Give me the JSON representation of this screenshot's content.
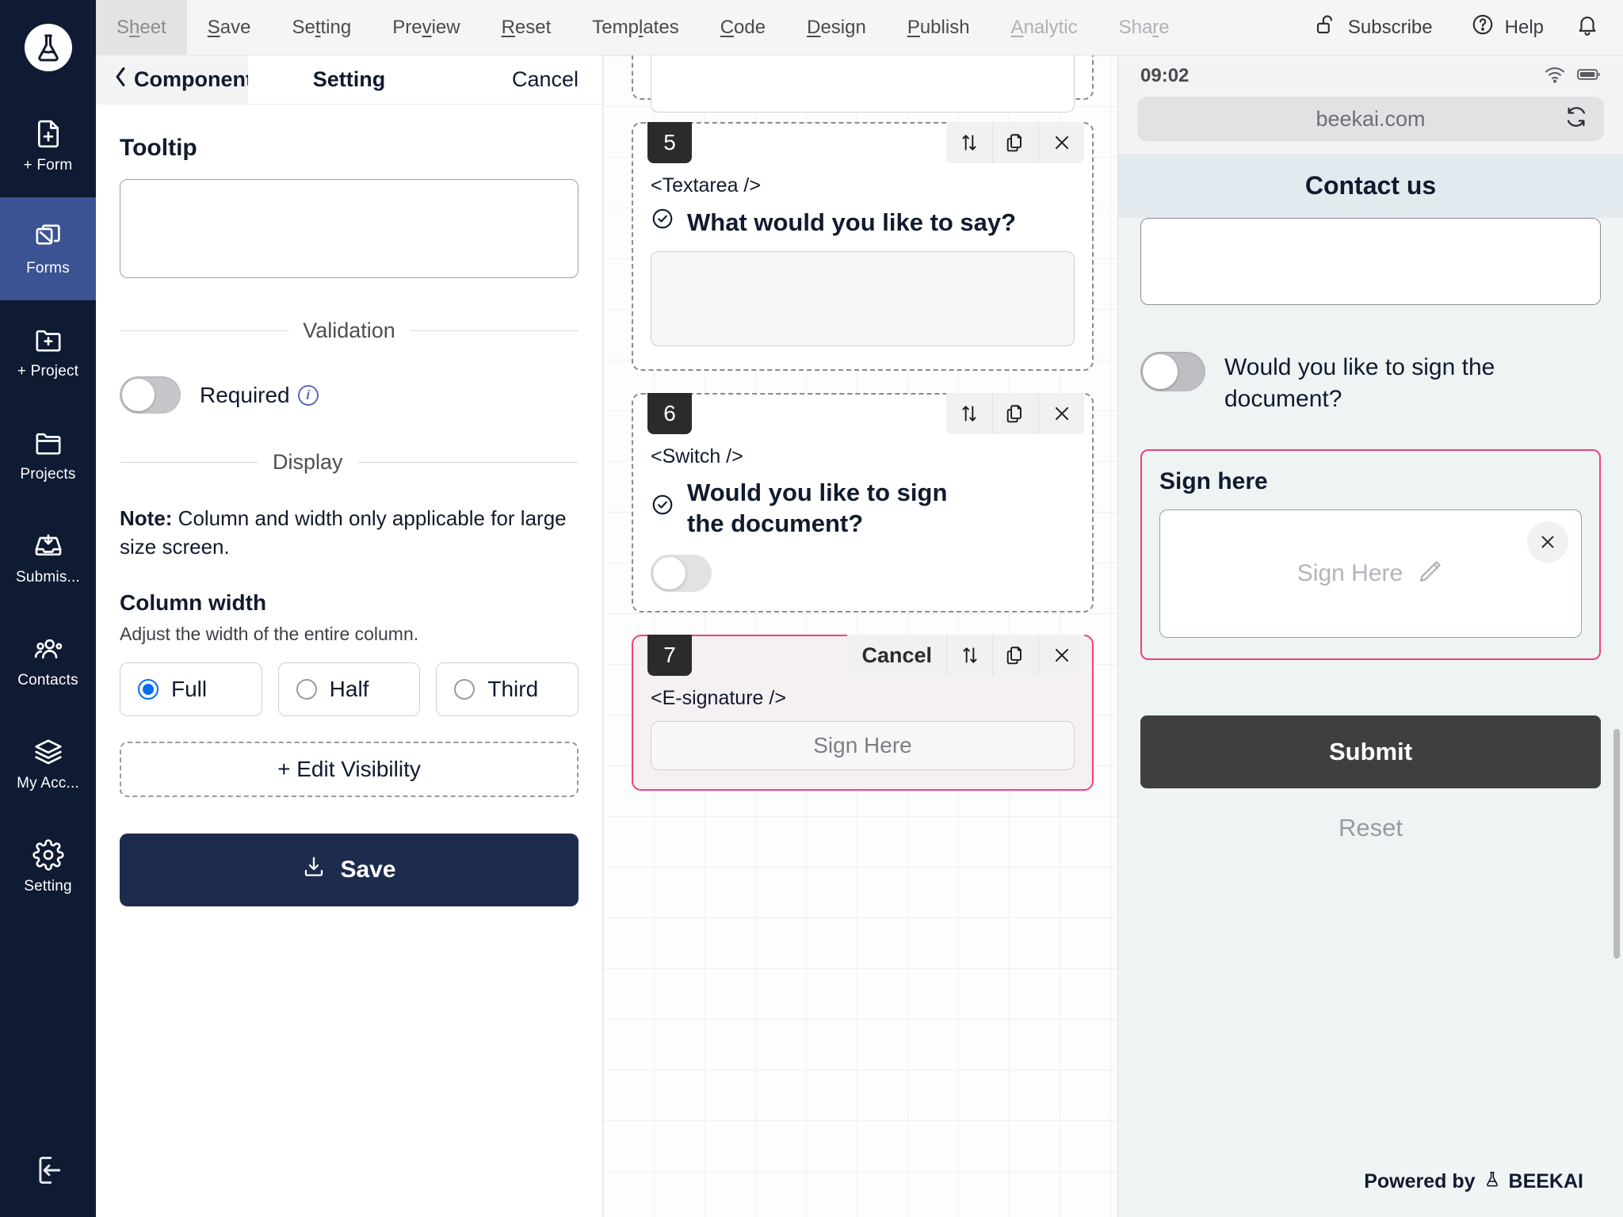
{
  "menubar": {
    "items": [
      {
        "label": "Sheet",
        "accel_index": 1,
        "state": "current"
      },
      {
        "label": "Save",
        "accel_index": 0,
        "state": "normal"
      },
      {
        "label": "Setting",
        "accel_index": 3,
        "state": "normal"
      },
      {
        "label": "Preview",
        "accel_index": 4,
        "state": "normal"
      },
      {
        "label": "Reset",
        "accel_index": 0,
        "state": "normal"
      },
      {
        "label": "Templates",
        "accel_index": 4,
        "state": "normal"
      },
      {
        "label": "Code",
        "accel_index": 0,
        "state": "normal"
      },
      {
        "label": "Design",
        "accel_index": 0,
        "state": "normal"
      },
      {
        "label": "Publish",
        "accel_index": 0,
        "state": "normal"
      },
      {
        "label": "Analytic",
        "accel_index": 0,
        "state": "dim"
      },
      {
        "label": "Share",
        "accel_index": 4,
        "state": "dim"
      }
    ],
    "subscribe_label": "Subscribe",
    "subscribe_icon": "unlock-icon",
    "help_label": "Help",
    "help_icon": "question-circle-icon",
    "bell_icon": "bell-icon"
  },
  "sidebar": {
    "logo_icon": "beekai-flask-logo",
    "items": [
      {
        "label": "+ Form",
        "icon": "file-plus-icon",
        "active": false
      },
      {
        "label": "Forms",
        "icon": "forms-stack-icon",
        "active": true
      },
      {
        "label": "+ Project",
        "icon": "folder-plus-icon",
        "active": false
      },
      {
        "label": "Projects",
        "icon": "folder-icon",
        "active": false
      },
      {
        "label": "Submis...",
        "icon": "inbox-download-icon",
        "active": false
      },
      {
        "label": "Contacts",
        "icon": "users-icon",
        "active": false
      },
      {
        "label": "My Acc...",
        "icon": "layers-icon",
        "active": false
      },
      {
        "label": "Setting",
        "icon": "gear-icon",
        "active": false
      }
    ],
    "logout_icon": "logout-icon",
    "active_color": "#3b5293",
    "bg_color": "#0f1a33"
  },
  "setting_panel": {
    "back_label": "Components",
    "back_icon": "chevron-left-icon",
    "title": "Setting",
    "cancel_label": "Cancel",
    "tooltip_label": "Tooltip",
    "tooltip_value": "",
    "tooltip_placeholder": "",
    "validation_divider": "Validation",
    "required_label": "Required",
    "required_info_icon": "info-icon",
    "required_on": false,
    "display_divider": "Display",
    "note_prefix": "Note:",
    "note_text": " Column and width only applicable for large size screen.",
    "column_width_heading": "Column width",
    "column_width_desc": "Adjust the width of the entire column.",
    "column_width_options": [
      {
        "label": "Full",
        "selected": true
      },
      {
        "label": "Half",
        "selected": false
      },
      {
        "label": "Third",
        "selected": false
      }
    ],
    "edit_visibility_label": "+ Edit Visibility",
    "save_label": "Save",
    "save_icon": "download-icon",
    "accent_color": "#0a6ef0",
    "save_bg": "#1d2b4d"
  },
  "canvas": {
    "cards": [
      {
        "number": "",
        "tag": "",
        "question": "",
        "type": "stub",
        "selected": false,
        "tools": []
      },
      {
        "number": "5",
        "tag": "<Textarea />",
        "question": "What would you like to say?",
        "type": "textarea",
        "selected": false,
        "tools": [
          "move-icon",
          "duplicate-icon",
          "close-icon"
        ]
      },
      {
        "number": "6",
        "tag": "<Switch />",
        "question": "Would you like to sign the document?",
        "type": "switch",
        "switch_on": false,
        "selected": false,
        "tools": [
          "move-icon",
          "duplicate-icon",
          "close-icon"
        ]
      },
      {
        "number": "7",
        "tag": "<E-signature />",
        "question": "",
        "type": "esignature",
        "sign_placeholder": "Sign Here",
        "cancel_label": "Cancel",
        "selected": true,
        "tools": [
          "move-icon",
          "duplicate-icon",
          "close-icon"
        ]
      }
    ],
    "selected_border_color": "#f0407f"
  },
  "preview": {
    "time": "09:02",
    "wifi_icon": "wifi-icon",
    "battery_icon": "battery-icon",
    "url": "beekai.com",
    "reload_icon": "reload-icon",
    "form_title": "Contact us",
    "textarea_value": "",
    "switch_label": "Would you like to sign the document?",
    "switch_on": false,
    "sign_section_title": "Sign here",
    "sign_placeholder": "Sign Here",
    "sign_pencil_icon": "pencil-icon",
    "clear_icon": "close-icon",
    "submit_label": "Submit",
    "reset_label": "Reset",
    "powered_by": "Powered by",
    "brand": "BEEKAI",
    "brand_icon": "beekai-flask-logo",
    "highlight_color": "#f0407f",
    "submit_bg": "#3f3f42"
  }
}
